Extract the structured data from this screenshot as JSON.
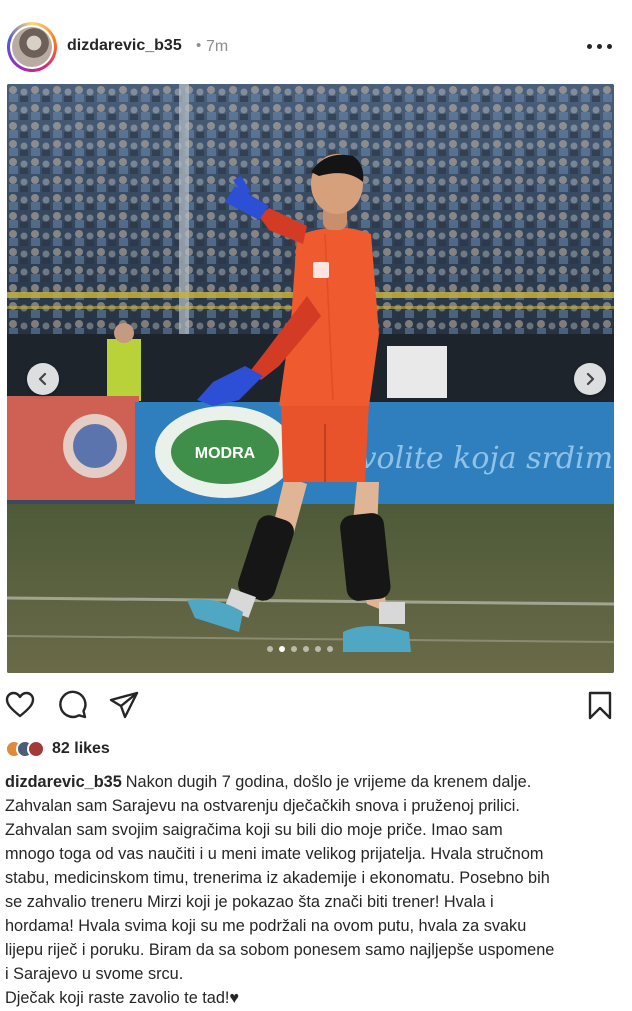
{
  "post": {
    "username": "dizdarevic_b35",
    "separator": "•",
    "time_ago": "7m"
  },
  "media": {
    "banner_text": "Zavolite koja srdim",
    "sponsor_logo": "MODRA",
    "slide_count": 6,
    "active_slide": 2
  },
  "engagement": {
    "likes_text": "82 likes"
  },
  "caption": {
    "username": "dizdarevic_b35",
    "lines": [
      "Nakon dugih 7 godina, došlo je vrijeme da krenem dalje.",
      "Zahvalan sam Sarajevu na ostvarenju dječačkih snova i pruženoj prilici.",
      "Zahvalan sam svojim saigračima koji su bili dio moje priče. Imao sam",
      "mnogo toga od vas naučiti i u meni imate velikog prijatelja. Hvala stručnom",
      "stabu, medicinskom timu, trenerima iz akademije i ekonomatu. Posebno bih",
      "se zahvalio treneru Mirzi koji je pokazao šta znači biti trener! Hvala i",
      "hordama! Hvala svima koji su me podržali na ovom putu, hvala za svaku",
      "lijepu riječ i poruku. Biram da sa sobom ponesem samo najljepše uspomene",
      "i Sarajevo u svome srcu.",
      "Dječak koji raste zavolio te tad!♥"
    ]
  },
  "icons": {
    "more": "more-options-icon",
    "like": "heart-icon",
    "comment": "comment-icon",
    "share": "share-icon",
    "save": "bookmark-icon",
    "prev": "chevron-left-icon",
    "next": "chevron-right-icon"
  },
  "colors": {
    "kit_orange": "#e8532c",
    "banner_blue": "#2f7fbf",
    "pitch_green": "#56603d",
    "text": "#262626",
    "muted": "#8e8e8e"
  }
}
